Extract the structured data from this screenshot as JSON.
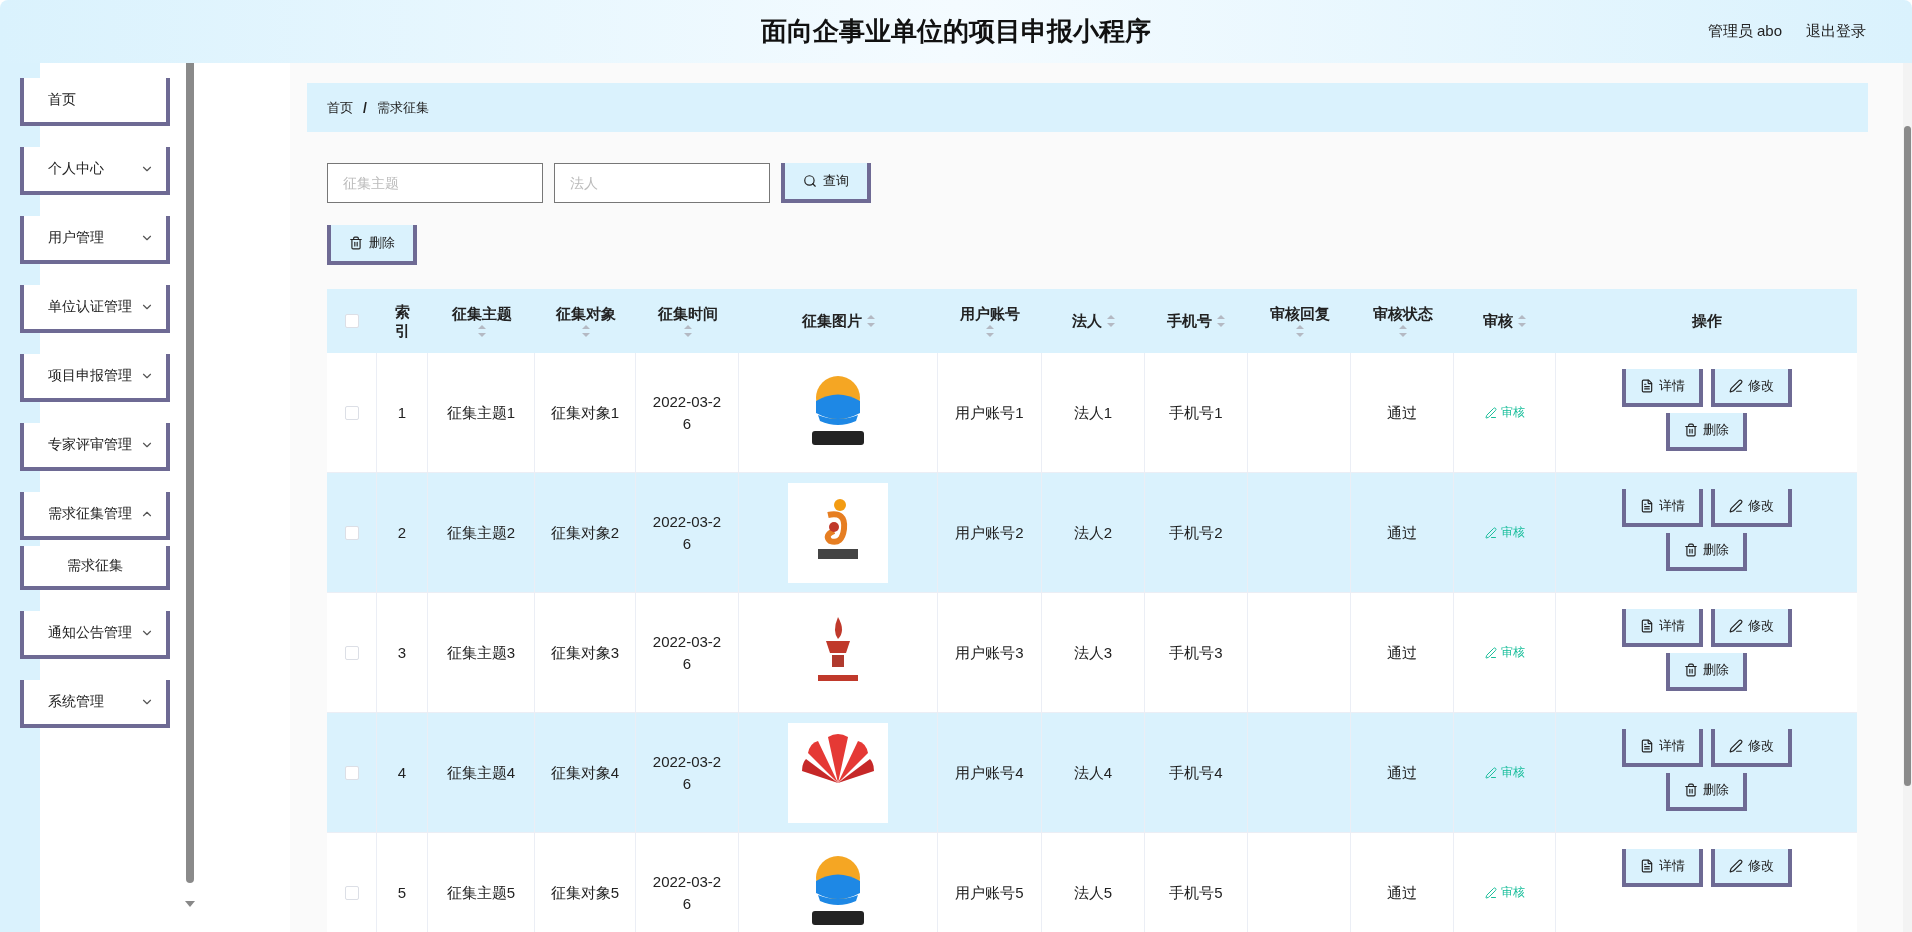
{
  "header": {
    "title": "面向企事业单位的项目申报小程序",
    "user": "管理员 abo",
    "logout": "退出登录"
  },
  "sidebar": {
    "items": [
      {
        "label": "首页",
        "kind": "link"
      },
      {
        "label": "个人中心",
        "kind": "group",
        "expanded": false
      },
      {
        "label": "用户管理",
        "kind": "group",
        "expanded": false
      },
      {
        "label": "单位认证管理",
        "kind": "group",
        "expanded": false
      },
      {
        "label": "项目申报管理",
        "kind": "group",
        "expanded": false
      },
      {
        "label": "专家评审管理",
        "kind": "group",
        "expanded": false
      },
      {
        "label": "需求征集管理",
        "kind": "group",
        "expanded": true,
        "children": [
          {
            "label": "需求征集"
          }
        ]
      },
      {
        "label": "通知公告管理",
        "kind": "group",
        "expanded": false
      },
      {
        "label": "系统管理",
        "kind": "group",
        "expanded": false
      }
    ]
  },
  "breadcrumb": {
    "items": [
      "首页",
      "需求征集"
    ],
    "separator": "/"
  },
  "search": {
    "fields": [
      {
        "placeholder": "征集主题"
      },
      {
        "placeholder": "法人"
      }
    ],
    "button": "查询"
  },
  "toolbar": {
    "delete": "删除"
  },
  "table": {
    "select_all": {
      "checked": false
    },
    "columns": [
      {
        "label": "索引",
        "sortable": false
      },
      {
        "label": "征集主题",
        "sortable": true
      },
      {
        "label": "征集对象",
        "sortable": true
      },
      {
        "label": "征集时间",
        "sortable": true
      },
      {
        "label": "征集图片",
        "sortable": true
      },
      {
        "label": "用户账号",
        "sortable": true
      },
      {
        "label": "法人",
        "sortable": true
      },
      {
        "label": "手机号",
        "sortable": true
      },
      {
        "label": "审核回复",
        "sortable": true
      },
      {
        "label": "审核状态",
        "sortable": true
      },
      {
        "label": "审核",
        "sortable": true
      },
      {
        "label": "操作",
        "sortable": false
      }
    ],
    "rows": [
      {
        "checked": false,
        "index": "1",
        "subject": "征集主题1",
        "target": "征集对象1",
        "time": "2022-03-26",
        "user": "用户账号1",
        "legal": "法人1",
        "phone": "手机号1",
        "status": "通过",
        "review": "审核",
        "actions": [
          {
            "kind": "detail",
            "label": "详情"
          },
          {
            "kind": "edit",
            "label": "修改"
          },
          {
            "kind": "delete",
            "label": "删除"
          }
        ]
      },
      {
        "checked": false,
        "index": "2",
        "subject": "征集主题2",
        "target": "征集对象2",
        "time": "2022-03-26",
        "user": "用户账号2",
        "legal": "法人2",
        "phone": "手机号2",
        "status": "通过",
        "review": "审核",
        "actions": [
          {
            "kind": "detail",
            "label": "详情"
          },
          {
            "kind": "edit",
            "label": "修改"
          },
          {
            "kind": "delete",
            "label": "删除"
          }
        ]
      },
      {
        "checked": false,
        "index": "3",
        "subject": "征集主题3",
        "target": "征集对象3",
        "time": "2022-03-26",
        "user": "用户账号3",
        "legal": "法人3",
        "phone": "手机号3",
        "status": "通过",
        "review": "审核",
        "actions": [
          {
            "kind": "detail",
            "label": "详情"
          },
          {
            "kind": "edit",
            "label": "修改"
          },
          {
            "kind": "delete",
            "label": "删除"
          }
        ]
      },
      {
        "checked": false,
        "index": "4",
        "subject": "征集主题4",
        "target": "征集对象4",
        "time": "2022-03-26",
        "user": "用户账号4",
        "legal": "法人4",
        "phone": "手机号4",
        "status": "通过",
        "review": "审核",
        "actions": [
          {
            "kind": "detail",
            "label": "详情"
          },
          {
            "kind": "edit",
            "label": "修改"
          },
          {
            "kind": "delete",
            "label": "删除"
          }
        ]
      },
      {
        "checked": false,
        "index": "5",
        "subject": "征集主题5",
        "target": "征集对象5",
        "time": "2022-03-26",
        "user": "用户账号5",
        "legal": "法人5",
        "phone": "手机号5",
        "status": "通过",
        "review": "审核",
        "actions": [
          {
            "kind": "detail",
            "label": "详情"
          },
          {
            "kind": "edit",
            "label": "修改"
          }
        ]
      }
    ]
  }
}
